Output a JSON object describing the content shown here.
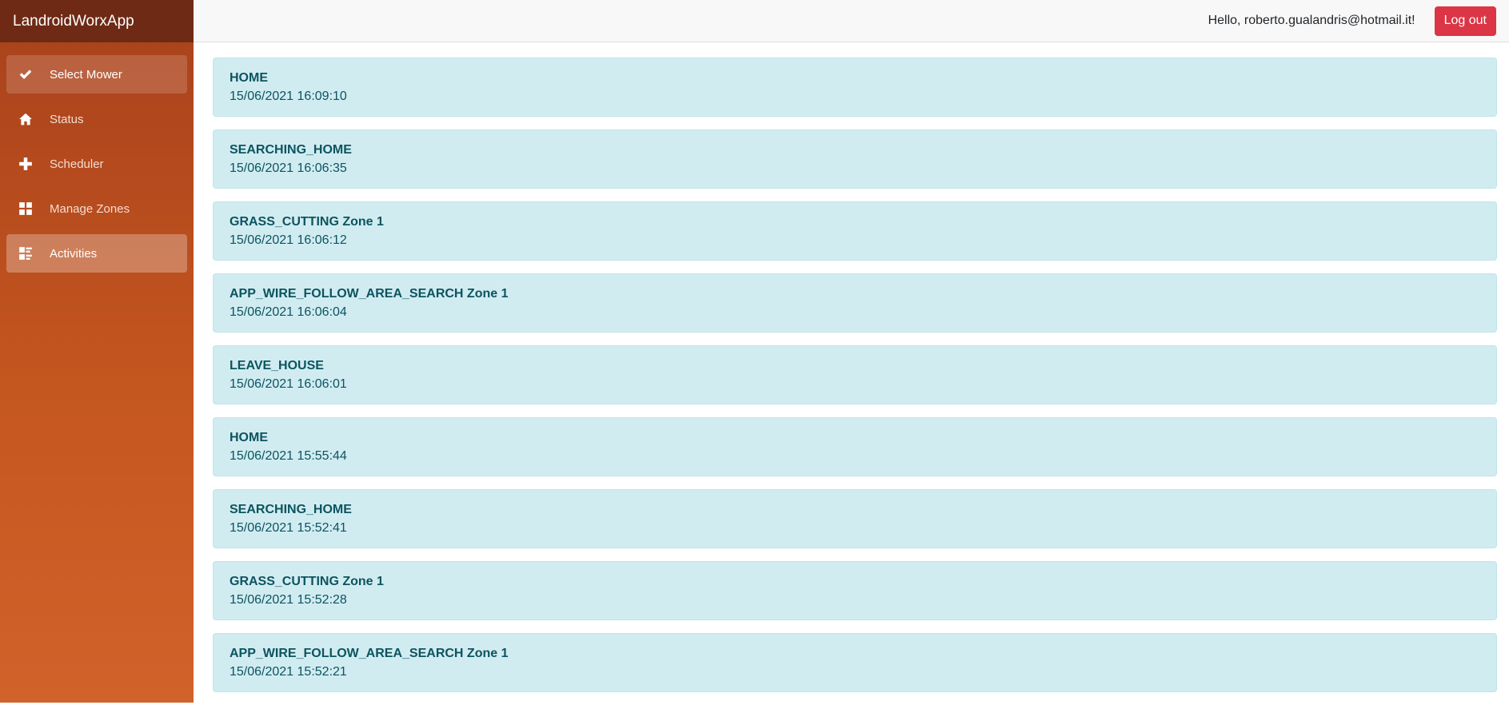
{
  "app": {
    "title": "LandroidWorxApp"
  },
  "sidebar": {
    "items": [
      {
        "label": "Select Mower",
        "icon": "check-icon"
      },
      {
        "label": "Status",
        "icon": "home-icon"
      },
      {
        "label": "Scheduler",
        "icon": "plus-icon"
      },
      {
        "label": "Manage Zones",
        "icon": "grid-icon"
      },
      {
        "label": "Activities",
        "icon": "list-icon"
      }
    ]
  },
  "header": {
    "greeting": "Hello, roberto.gualandris@hotmail.it!",
    "logout_label": "Log out"
  },
  "activities": [
    {
      "name": "HOME",
      "time": "15/06/2021 16:09:10"
    },
    {
      "name": "SEARCHING_HOME",
      "time": "15/06/2021 16:06:35"
    },
    {
      "name": "GRASS_CUTTING Zone 1",
      "time": "15/06/2021 16:06:12"
    },
    {
      "name": "APP_WIRE_FOLLOW_AREA_SEARCH Zone 1",
      "time": "15/06/2021 16:06:04"
    },
    {
      "name": "LEAVE_HOUSE",
      "time": "15/06/2021 16:06:01"
    },
    {
      "name": "HOME",
      "time": "15/06/2021 15:55:44"
    },
    {
      "name": "SEARCHING_HOME",
      "time": "15/06/2021 15:52:41"
    },
    {
      "name": "GRASS_CUTTING Zone 1",
      "time": "15/06/2021 15:52:28"
    },
    {
      "name": "APP_WIRE_FOLLOW_AREA_SEARCH Zone 1",
      "time": "15/06/2021 15:52:21"
    }
  ],
  "colors": {
    "sidebar_top": "#a8411c",
    "sidebar_bottom": "#d1622a",
    "brand_bar": "#6e2a14",
    "alert_bg": "#d1ecf1",
    "alert_text": "#0c5460",
    "logout_button": "#dc3545"
  }
}
